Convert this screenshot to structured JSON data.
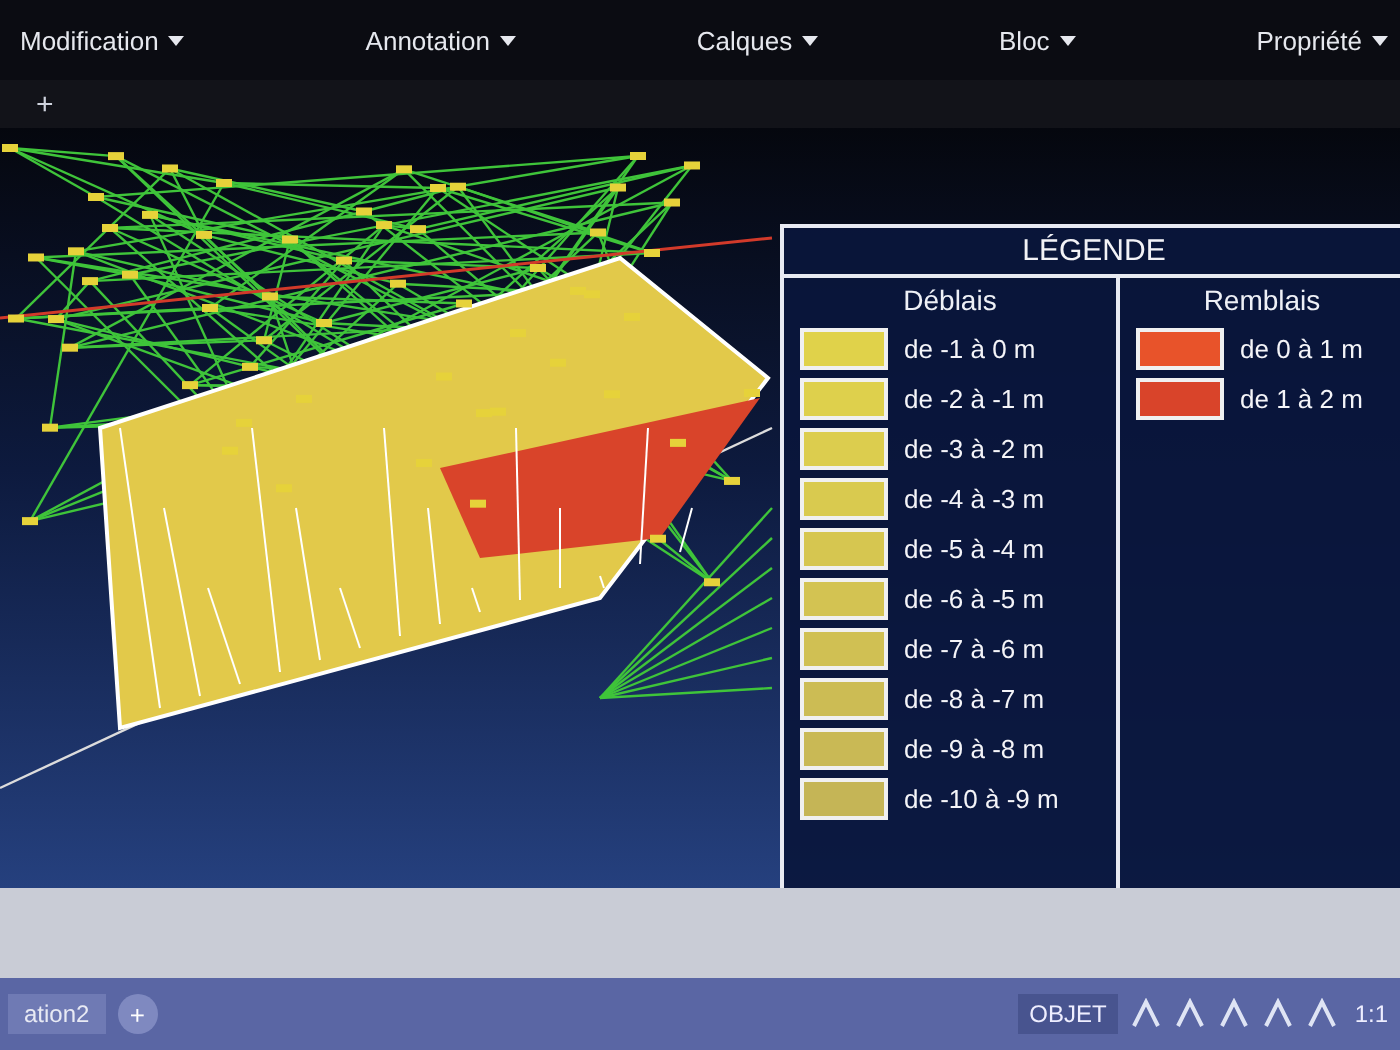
{
  "ribbon": {
    "panels": [
      {
        "label": "Modification"
      },
      {
        "label": "Annotation"
      },
      {
        "label": "Calques"
      },
      {
        "label": "Bloc"
      },
      {
        "label": "Propriété"
      }
    ]
  },
  "file_tab": {
    "add": "+"
  },
  "legend": {
    "title": "LÉGENDE",
    "columns": [
      {
        "heading": "Déblais",
        "items": [
          {
            "label": "de -1 à 0 m",
            "color": "#e0d24a"
          },
          {
            "label": "de -2 à -1 m",
            "color": "#ded04c"
          },
          {
            "label": "de -3 à -2 m",
            "color": "#dccd4e"
          },
          {
            "label": "de -4 à -3 m",
            "color": "#d9ca4f"
          },
          {
            "label": "de -5 à -4 m",
            "color": "#d6c650"
          },
          {
            "label": "de -6 à -5 m",
            "color": "#d3c352"
          },
          {
            "label": "de -7 à -6 m",
            "color": "#d0c053"
          },
          {
            "label": "de -8 à -7 m",
            "color": "#ccbc54"
          },
          {
            "label": "de -9 à -8 m",
            "color": "#c9b955"
          },
          {
            "label": "de -10 à -9 m",
            "color": "#c5b556"
          }
        ]
      },
      {
        "heading": "Remblais",
        "items": [
          {
            "label": "de 0 à 1 m",
            "color": "#e8532a"
          },
          {
            "label": "de 1 à 2 m",
            "color": "#d9442a"
          }
        ]
      }
    ]
  },
  "layout_tab": {
    "label": "ation2",
    "add": "+"
  },
  "status_bar": {
    "mode": "OBJET",
    "scale": "1:1"
  }
}
